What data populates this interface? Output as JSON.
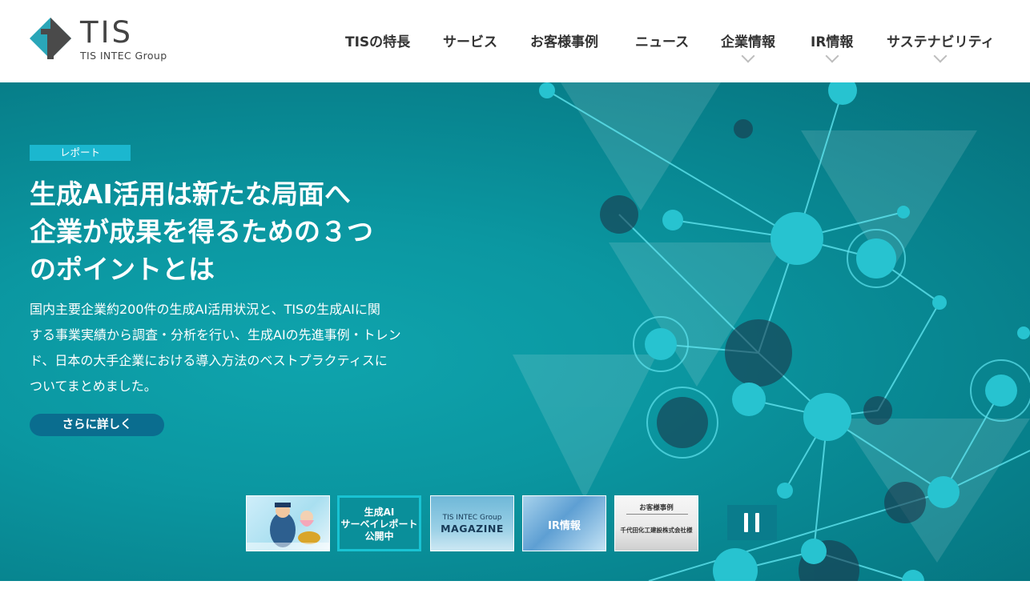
{
  "brand": {
    "name": "TIS",
    "sub": "TIS INTEC Group",
    "colors": {
      "teal": "#2aa6b8",
      "dark": "#4a4a4a"
    }
  },
  "nav": {
    "items": [
      {
        "label": "TISの特長",
        "has_dropdown": false
      },
      {
        "label": "サービス",
        "has_dropdown": false
      },
      {
        "label": "お客様事例",
        "has_dropdown": false
      },
      {
        "label": "ニュース",
        "has_dropdown": false
      },
      {
        "label": "企業情報",
        "has_dropdown": true
      },
      {
        "label": "IR情報",
        "has_dropdown": true
      },
      {
        "label": "サステナビリティ",
        "has_dropdown": true
      }
    ]
  },
  "hero": {
    "tag": "レポート",
    "headline": [
      "生成AI活用は新たな局面へ",
      "企業が成果を得るための３つ",
      "のポイントとは"
    ],
    "description": [
      "国内主要企業約200件の生成AI活用状況と、TISの生成AIに関",
      "する事業実績から調査・分析を行い、生成AIの先進事例・トレン",
      "ド、日本の大手企業における導入方法のベストプラクティスに",
      "ついてまとめました。"
    ],
    "cta": "さらに詳しく"
  },
  "carousel": {
    "thumbs": [
      {
        "label": "",
        "kind": "ad-photo"
      },
      {
        "label": "生成AI\nサーベイレポート\n公開中",
        "lines": [
          "生成AI",
          "サーベイレポート",
          "公開中"
        ],
        "active": true
      },
      {
        "label": "TIS INTEC Group MAGAZINE",
        "top": "TIS INTEC Group",
        "main": "MAGAZINE"
      },
      {
        "label": "IR情報"
      },
      {
        "label": "お客様事例 千代田化工建設株式会社様",
        "top": "お客様事例",
        "main": "千代田化工建設株式会社様"
      }
    ],
    "pause_icon": "pause-icon"
  }
}
